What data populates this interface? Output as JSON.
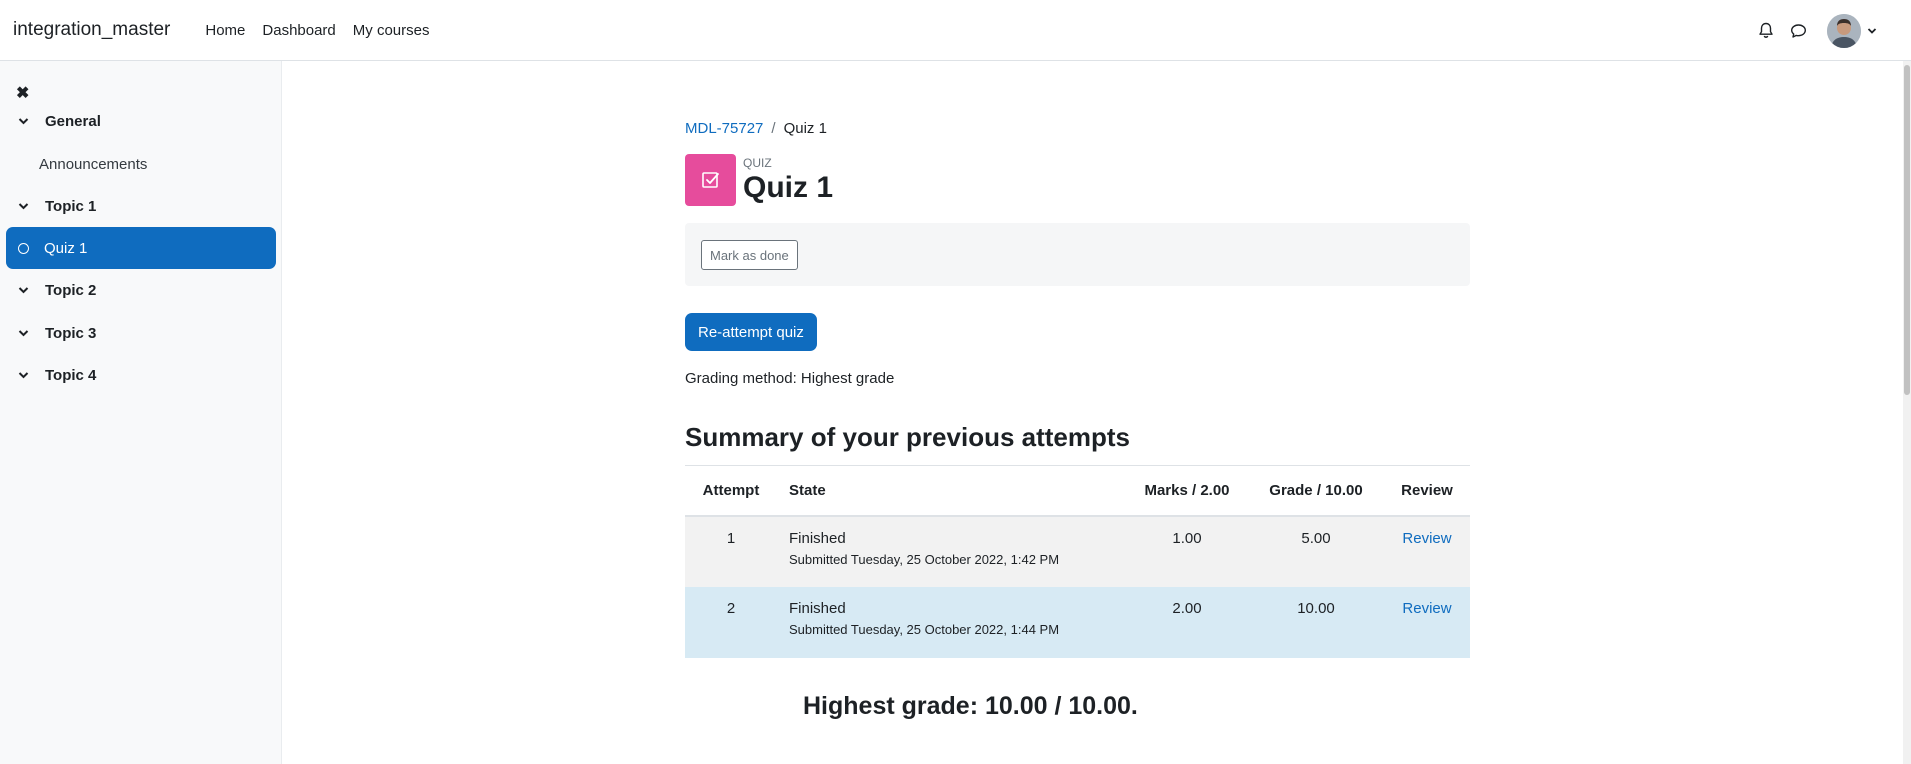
{
  "navbar": {
    "brand": "integration_master",
    "links": [
      "Home",
      "Dashboard",
      "My courses"
    ]
  },
  "drawer": {
    "items": [
      {
        "label": "General",
        "type": "section"
      },
      {
        "label": "Announcements",
        "type": "sub"
      },
      {
        "label": "Topic 1",
        "type": "section"
      },
      {
        "label": "Quiz 1",
        "type": "active"
      },
      {
        "label": "Topic 2",
        "type": "section"
      },
      {
        "label": "Topic 3",
        "type": "section"
      },
      {
        "label": "Topic 4",
        "type": "section"
      }
    ]
  },
  "breadcrumb": {
    "course": "MDL-75727",
    "separator": "/",
    "current": "Quiz 1"
  },
  "activity": {
    "type_label": "QUIZ",
    "title": "Quiz 1",
    "icon_color": "#e64c9c"
  },
  "completion": {
    "mark_done_label": "Mark as done"
  },
  "actions": {
    "reattempt_label": "Re-attempt quiz"
  },
  "grading_method": "Grading method: Highest grade",
  "summary": {
    "title": "Summary of your previous attempts",
    "headers": [
      "Attempt",
      "State",
      "Marks / 2.00",
      "Grade / 10.00",
      "Review"
    ],
    "rows": [
      {
        "attempt": "1",
        "state": "Finished",
        "submitted": "Submitted Tuesday, 25 October 2022, 1:42 PM",
        "marks": "1.00",
        "grade": "5.00",
        "review": "Review"
      },
      {
        "attempt": "2",
        "state": "Finished",
        "submitted": "Submitted Tuesday, 25 October 2022, 1:44 PM",
        "marks": "2.00",
        "grade": "10.00",
        "review": "Review"
      }
    ]
  },
  "highest_grade": "Highest grade: 10.00 / 10.00.",
  "colors": {
    "primary": "#0f6cbf",
    "quiz_icon": "#e64c9c",
    "row_highlight": "#d7eaf4"
  }
}
